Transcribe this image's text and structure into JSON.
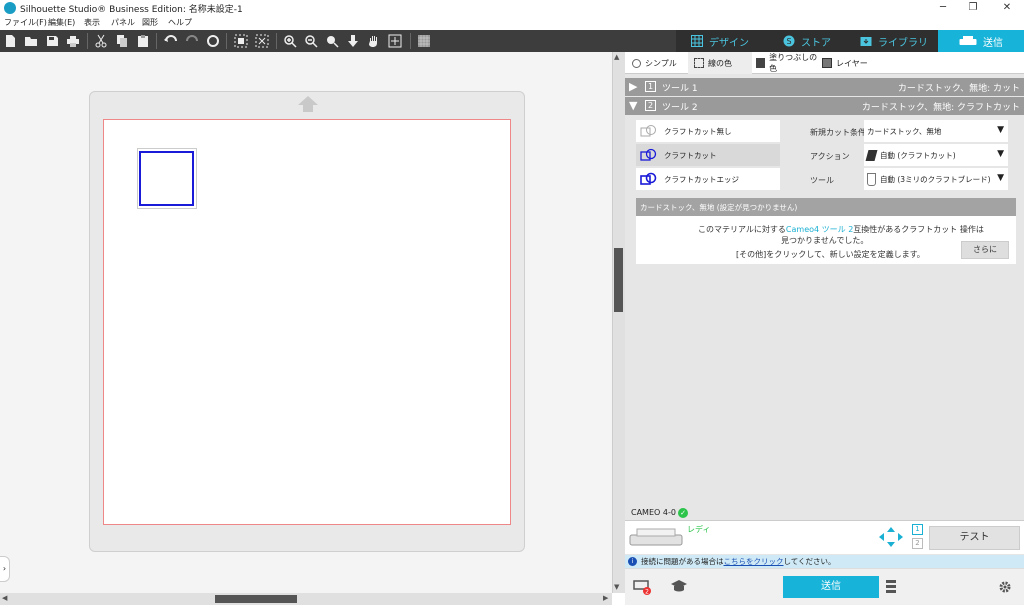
{
  "window": {
    "title": "Silhouette Studio® Business Edition: 名称未設定-1",
    "minimize": "─",
    "restore": "❐",
    "close": "✕"
  },
  "menu": [
    "ファイル(F)",
    "編集(E)",
    "表示",
    "パネル",
    "図形",
    "ヘルプ"
  ],
  "top_tabs": [
    {
      "label": "デザイン",
      "icon": "grid-icon",
      "active": false
    },
    {
      "label": "ストア",
      "icon": "store-icon",
      "active": false
    },
    {
      "label": "ライブラリ",
      "icon": "library-icon",
      "active": false
    },
    {
      "label": "送信",
      "icon": "send-machine-icon",
      "active": true
    }
  ],
  "panel": {
    "subtabs": [
      "シンプル",
      "線の色",
      "塗りつぶしの色",
      "レイヤー"
    ],
    "tool1": {
      "num": "1",
      "label": "ツール 1",
      "summary": "カードストック、無地: カット"
    },
    "tool2": {
      "num": "2",
      "label": "ツール 2",
      "summary": "カードストック、無地: クラフトカット"
    },
    "cut_options": [
      "クラフトカット無し",
      "クラフトカット",
      "クラフトカットエッジ"
    ],
    "fields": {
      "material_label": "新規カット条件",
      "material_value": "カードストック、無地",
      "action_label": "アクション",
      "action_value": "自動 (クラフトカット)",
      "tool_label": "ツール",
      "tool_value": "自動 (3ミリのクラフトブレード)"
    },
    "warning": {
      "header": "カードストック、無地 (設定が見つかりません)",
      "line1_a": "このマテリアルに対する",
      "line1_b": "Cameo4 ツール 2",
      "line1_c": "互換性があるクラフトカット 操作は",
      "line2": "見つかりませんでした。",
      "line3": "[その他]をクリックして、新しい設定を定義します。",
      "more_button": "さらに"
    },
    "device": {
      "name": "CAMEO 4-0",
      "status": "レディ",
      "tool_slots": [
        "1",
        "2"
      ],
      "test_button": "テスト"
    },
    "info": {
      "text_before": "接続に問題がある場合は",
      "link": "こちらをクリック",
      "text_after": "してください。"
    },
    "send_button": "送信"
  },
  "colors": {
    "accent": "#18b3d8",
    "shape_stroke": "#1a1ad9",
    "page_border": "#ee8888",
    "status_green": "#2cc44a"
  }
}
